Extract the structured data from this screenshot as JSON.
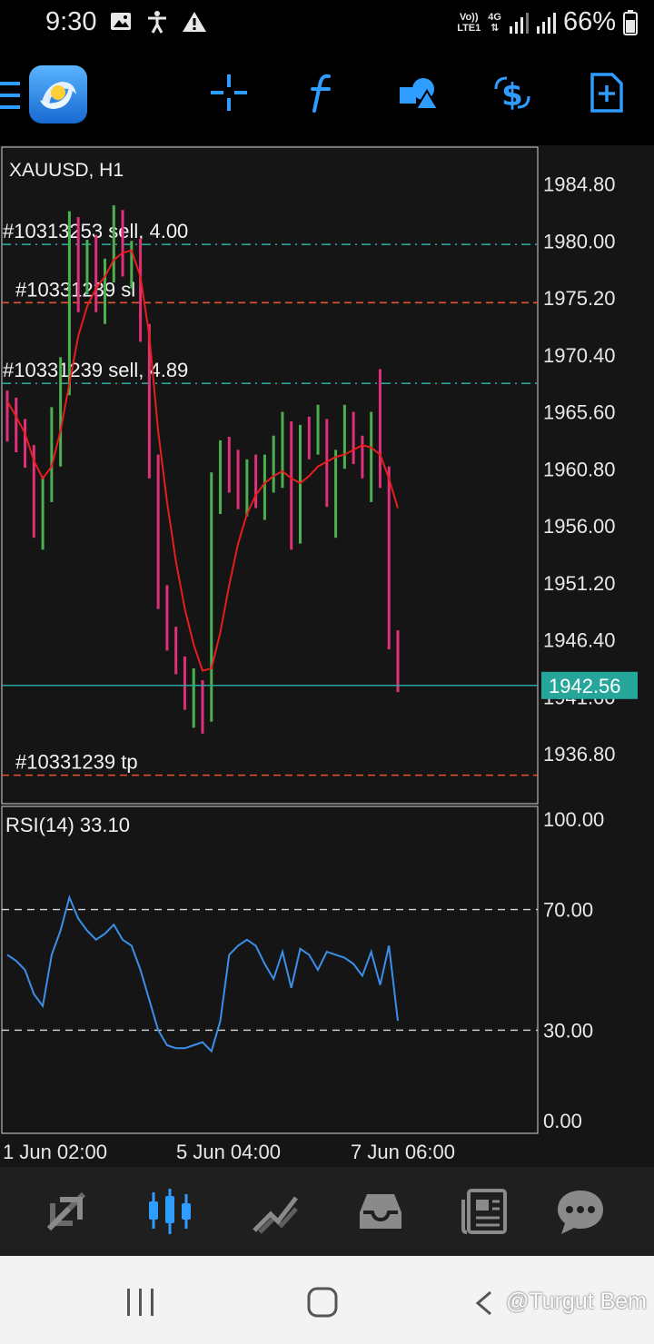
{
  "status_bar": {
    "time": "9:30",
    "network_top": "Vo))",
    "network_bottom": "LTE1",
    "network_gen": "4G",
    "battery": "66%"
  },
  "toolbar": {
    "buttons": [
      "crosshair-icon",
      "indicators-icon",
      "objects-icon",
      "trade-icon",
      "new-order-icon"
    ]
  },
  "chart": {
    "symbol_label": "XAUUSD, H1",
    "price_ticks": [
      "1984.80",
      "1980.00",
      "1975.20",
      "1970.40",
      "1965.60",
      "1960.80",
      "1956.00",
      "1951.20",
      "1946.40",
      "1941.60",
      "1936.80"
    ],
    "current_price": "1942.56",
    "orders": [
      {
        "label": "#10313253 sell, 4.00",
        "price": 1979.7,
        "kind": "order",
        "color": "#2aa39a"
      },
      {
        "label": "#10331239 sl",
        "price": 1974.8,
        "kind": "sl",
        "color": "#e8542e"
      },
      {
        "label": "#10331239 sell, 4.89",
        "price": 1968.0,
        "kind": "order",
        "color": "#2aa39a"
      },
      {
        "label": "#10331239 tp",
        "price": 1935.0,
        "kind": "tp",
        "color": "#e8542e"
      }
    ],
    "rsi_label": "RSI(14) 33.10",
    "rsi_ticks": [
      "100.00",
      "70.00",
      "30.00",
      "0.00"
    ],
    "time_labels": [
      "1 Jun 02:00",
      "5 Jun 04:00",
      "7 Jun 06:00"
    ]
  },
  "bottom_nav": [
    "quotes-icon",
    "chart-icon",
    "trade-icon",
    "history-icon",
    "news-icon",
    "messages-icon"
  ],
  "system_nav": [
    "recent-apps-icon",
    "home-icon",
    "back-icon"
  ],
  "watermark": "@Turgut Bem",
  "colors": {
    "bull": "#4caf50",
    "bear": "#e0307a",
    "ma": "#e81d1d",
    "rsi": "#3b8fe8",
    "accent": "#2f9cff",
    "price_line": "#26a69a"
  },
  "chart_data": {
    "type": "candlestick",
    "series": [
      {
        "name": "XAUUSD, H1",
        "values": [
          [
            1966.2,
            1967.4,
            1963.1,
            1965.0
          ],
          [
            1965.0,
            1966.8,
            1962.2,
            1963.5
          ],
          [
            1963.5,
            1965.0,
            1960.9,
            1962.0
          ],
          [
            1962.0,
            1962.8,
            1955.0,
            1956.0
          ],
          [
            1956.0,
            1960.2,
            1954.0,
            1959.5
          ],
          [
            1959.5,
            1966.0,
            1958.0,
            1965.5
          ],
          [
            1965.5,
            1970.2,
            1961.0,
            1969.0
          ],
          [
            1969.0,
            1982.5,
            1967.0,
            1981.0
          ],
          [
            1981.0,
            1982.0,
            1974.0,
            1976.0
          ],
          [
            1976.0,
            1980.1,
            1975.5,
            1979.5
          ],
          [
            1979.5,
            1980.5,
            1974.0,
            1975.0
          ],
          [
            1975.0,
            1978.5,
            1973.0,
            1977.0
          ],
          [
            1977.0,
            1983.0,
            1976.5,
            1982.0
          ],
          [
            1982.0,
            1982.6,
            1977.0,
            1978.0
          ],
          [
            1978.0,
            1980.0,
            1976.0,
            1979.0
          ],
          [
            1979.0,
            1980.2,
            1971.5,
            1972.0
          ],
          [
            1972.0,
            1973.0,
            1960.0,
            1961.0
          ],
          [
            1961.0,
            1962.0,
            1949.0,
            1950.0
          ],
          [
            1950.0,
            1951.0,
            1945.5,
            1946.5
          ],
          [
            1946.5,
            1947.5,
            1943.5,
            1944.5
          ],
          [
            1944.5,
            1945.0,
            1940.5,
            1941.5
          ],
          [
            1941.5,
            1944.0,
            1939.0,
            1942.5
          ],
          [
            1942.5,
            1943.0,
            1938.5,
            1940.0
          ],
          [
            1940.0,
            1960.5,
            1939.5,
            1960.0
          ],
          [
            1960.0,
            1963.2,
            1957.0,
            1962.0
          ],
          [
            1962.0,
            1963.5,
            1958.8,
            1960.0
          ],
          [
            1960.0,
            1962.4,
            1957.4,
            1958.0
          ],
          [
            1958.0,
            1961.6,
            1956.8,
            1961.0
          ],
          [
            1961.0,
            1962.0,
            1957.5,
            1958.5
          ],
          [
            1958.5,
            1962.0,
            1956.5,
            1960.0
          ],
          [
            1960.0,
            1963.6,
            1958.8,
            1962.5
          ],
          [
            1962.5,
            1965.6,
            1959.2,
            1963.0
          ],
          [
            1963.0,
            1964.8,
            1954.0,
            1955.0
          ],
          [
            1955.0,
            1964.5,
            1954.5,
            1964.0
          ],
          [
            1964.0,
            1965.2,
            1961.6,
            1963.0
          ],
          [
            1963.0,
            1966.2,
            1962.0,
            1964.0
          ],
          [
            1964.0,
            1965.0,
            1957.6,
            1958.0
          ],
          [
            1958.0,
            1962.4,
            1955.0,
            1961.8
          ],
          [
            1961.8,
            1966.2,
            1960.8,
            1965.0
          ],
          [
            1965.0,
            1965.6,
            1961.2,
            1962.0
          ],
          [
            1962.0,
            1963.6,
            1960.0,
            1961.0
          ],
          [
            1961.0,
            1965.6,
            1958.0,
            1964.5
          ],
          [
            1964.5,
            1969.2,
            1959.2,
            1960.0
          ],
          [
            1960.0,
            1961.0,
            1945.6,
            1946.5
          ],
          [
            1946.5,
            1947.2,
            1942.0,
            1942.6
          ]
        ]
      },
      {
        "name": "MA",
        "values": [
          1966.5,
          1965.2,
          1963.8,
          1961.5,
          1960.0,
          1961.0,
          1964.0,
          1968.0,
          1972.0,
          1974.5,
          1976.0,
          1977.0,
          1978.4,
          1979.0,
          1979.2,
          1977.0,
          1972.0,
          1964.0,
          1958.0,
          1953.0,
          1949.0,
          1946.0,
          1943.8,
          1944.0,
          1947.0,
          1951.0,
          1954.5,
          1957.0,
          1958.6,
          1959.6,
          1960.2,
          1960.6,
          1960.0,
          1959.6,
          1960.2,
          1961.0,
          1961.4,
          1961.8,
          1962.0,
          1962.4,
          1962.8,
          1962.6,
          1962.0,
          1960.0,
          1957.5
        ]
      },
      {
        "name": "RSI(14)",
        "values": [
          55,
          53,
          50,
          42,
          38,
          55,
          63,
          74,
          67,
          63,
          60,
          62,
          65,
          60,
          58,
          50,
          40,
          30,
          25,
          24,
          24,
          25,
          26,
          23,
          33,
          55,
          58,
          60,
          58,
          52,
          47,
          56,
          44,
          57,
          55,
          50,
          56,
          55,
          54,
          52,
          48,
          56,
          45,
          58,
          33.1
        ]
      }
    ],
    "ylim": [
      1932.6,
      1987.9
    ],
    "rsi_levels": [
      70,
      30
    ],
    "rsi_range": [
      0,
      100
    ]
  }
}
